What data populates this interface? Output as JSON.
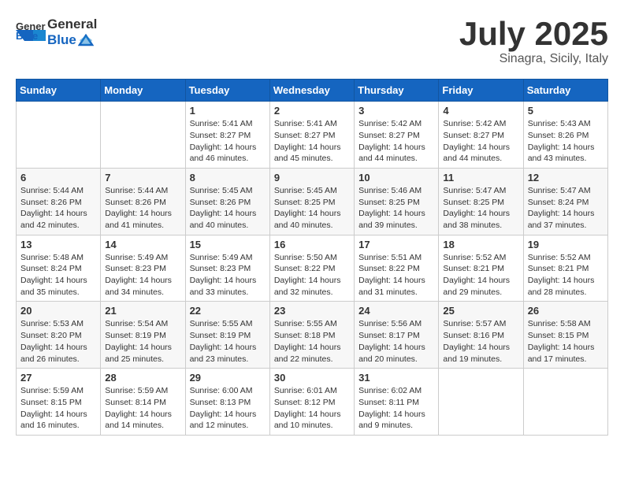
{
  "header": {
    "logo_general": "General",
    "logo_blue": "Blue",
    "month": "July 2025",
    "location": "Sinagra, Sicily, Italy"
  },
  "weekdays": [
    "Sunday",
    "Monday",
    "Tuesday",
    "Wednesday",
    "Thursday",
    "Friday",
    "Saturday"
  ],
  "weeks": [
    [
      {
        "day": "",
        "sunrise": "",
        "sunset": "",
        "daylight": ""
      },
      {
        "day": "",
        "sunrise": "",
        "sunset": "",
        "daylight": ""
      },
      {
        "day": "1",
        "sunrise": "Sunrise: 5:41 AM",
        "sunset": "Sunset: 8:27 PM",
        "daylight": "Daylight: 14 hours and 46 minutes."
      },
      {
        "day": "2",
        "sunrise": "Sunrise: 5:41 AM",
        "sunset": "Sunset: 8:27 PM",
        "daylight": "Daylight: 14 hours and 45 minutes."
      },
      {
        "day": "3",
        "sunrise": "Sunrise: 5:42 AM",
        "sunset": "Sunset: 8:27 PM",
        "daylight": "Daylight: 14 hours and 44 minutes."
      },
      {
        "day": "4",
        "sunrise": "Sunrise: 5:42 AM",
        "sunset": "Sunset: 8:27 PM",
        "daylight": "Daylight: 14 hours and 44 minutes."
      },
      {
        "day": "5",
        "sunrise": "Sunrise: 5:43 AM",
        "sunset": "Sunset: 8:26 PM",
        "daylight": "Daylight: 14 hours and 43 minutes."
      }
    ],
    [
      {
        "day": "6",
        "sunrise": "Sunrise: 5:44 AM",
        "sunset": "Sunset: 8:26 PM",
        "daylight": "Daylight: 14 hours and 42 minutes."
      },
      {
        "day": "7",
        "sunrise": "Sunrise: 5:44 AM",
        "sunset": "Sunset: 8:26 PM",
        "daylight": "Daylight: 14 hours and 41 minutes."
      },
      {
        "day": "8",
        "sunrise": "Sunrise: 5:45 AM",
        "sunset": "Sunset: 8:26 PM",
        "daylight": "Daylight: 14 hours and 40 minutes."
      },
      {
        "day": "9",
        "sunrise": "Sunrise: 5:45 AM",
        "sunset": "Sunset: 8:25 PM",
        "daylight": "Daylight: 14 hours and 40 minutes."
      },
      {
        "day": "10",
        "sunrise": "Sunrise: 5:46 AM",
        "sunset": "Sunset: 8:25 PM",
        "daylight": "Daylight: 14 hours and 39 minutes."
      },
      {
        "day": "11",
        "sunrise": "Sunrise: 5:47 AM",
        "sunset": "Sunset: 8:25 PM",
        "daylight": "Daylight: 14 hours and 38 minutes."
      },
      {
        "day": "12",
        "sunrise": "Sunrise: 5:47 AM",
        "sunset": "Sunset: 8:24 PM",
        "daylight": "Daylight: 14 hours and 37 minutes."
      }
    ],
    [
      {
        "day": "13",
        "sunrise": "Sunrise: 5:48 AM",
        "sunset": "Sunset: 8:24 PM",
        "daylight": "Daylight: 14 hours and 35 minutes."
      },
      {
        "day": "14",
        "sunrise": "Sunrise: 5:49 AM",
        "sunset": "Sunset: 8:23 PM",
        "daylight": "Daylight: 14 hours and 34 minutes."
      },
      {
        "day": "15",
        "sunrise": "Sunrise: 5:49 AM",
        "sunset": "Sunset: 8:23 PM",
        "daylight": "Daylight: 14 hours and 33 minutes."
      },
      {
        "day": "16",
        "sunrise": "Sunrise: 5:50 AM",
        "sunset": "Sunset: 8:22 PM",
        "daylight": "Daylight: 14 hours and 32 minutes."
      },
      {
        "day": "17",
        "sunrise": "Sunrise: 5:51 AM",
        "sunset": "Sunset: 8:22 PM",
        "daylight": "Daylight: 14 hours and 31 minutes."
      },
      {
        "day": "18",
        "sunrise": "Sunrise: 5:52 AM",
        "sunset": "Sunset: 8:21 PM",
        "daylight": "Daylight: 14 hours and 29 minutes."
      },
      {
        "day": "19",
        "sunrise": "Sunrise: 5:52 AM",
        "sunset": "Sunset: 8:21 PM",
        "daylight": "Daylight: 14 hours and 28 minutes."
      }
    ],
    [
      {
        "day": "20",
        "sunrise": "Sunrise: 5:53 AM",
        "sunset": "Sunset: 8:20 PM",
        "daylight": "Daylight: 14 hours and 26 minutes."
      },
      {
        "day": "21",
        "sunrise": "Sunrise: 5:54 AM",
        "sunset": "Sunset: 8:19 PM",
        "daylight": "Daylight: 14 hours and 25 minutes."
      },
      {
        "day": "22",
        "sunrise": "Sunrise: 5:55 AM",
        "sunset": "Sunset: 8:19 PM",
        "daylight": "Daylight: 14 hours and 23 minutes."
      },
      {
        "day": "23",
        "sunrise": "Sunrise: 5:55 AM",
        "sunset": "Sunset: 8:18 PM",
        "daylight": "Daylight: 14 hours and 22 minutes."
      },
      {
        "day": "24",
        "sunrise": "Sunrise: 5:56 AM",
        "sunset": "Sunset: 8:17 PM",
        "daylight": "Daylight: 14 hours and 20 minutes."
      },
      {
        "day": "25",
        "sunrise": "Sunrise: 5:57 AM",
        "sunset": "Sunset: 8:16 PM",
        "daylight": "Daylight: 14 hours and 19 minutes."
      },
      {
        "day": "26",
        "sunrise": "Sunrise: 5:58 AM",
        "sunset": "Sunset: 8:15 PM",
        "daylight": "Daylight: 14 hours and 17 minutes."
      }
    ],
    [
      {
        "day": "27",
        "sunrise": "Sunrise: 5:59 AM",
        "sunset": "Sunset: 8:15 PM",
        "daylight": "Daylight: 14 hours and 16 minutes."
      },
      {
        "day": "28",
        "sunrise": "Sunrise: 5:59 AM",
        "sunset": "Sunset: 8:14 PM",
        "daylight": "Daylight: 14 hours and 14 minutes."
      },
      {
        "day": "29",
        "sunrise": "Sunrise: 6:00 AM",
        "sunset": "Sunset: 8:13 PM",
        "daylight": "Daylight: 14 hours and 12 minutes."
      },
      {
        "day": "30",
        "sunrise": "Sunrise: 6:01 AM",
        "sunset": "Sunset: 8:12 PM",
        "daylight": "Daylight: 14 hours and 10 minutes."
      },
      {
        "day": "31",
        "sunrise": "Sunrise: 6:02 AM",
        "sunset": "Sunset: 8:11 PM",
        "daylight": "Daylight: 14 hours and 9 minutes."
      },
      {
        "day": "",
        "sunrise": "",
        "sunset": "",
        "daylight": ""
      },
      {
        "day": "",
        "sunrise": "",
        "sunset": "",
        "daylight": ""
      }
    ]
  ]
}
